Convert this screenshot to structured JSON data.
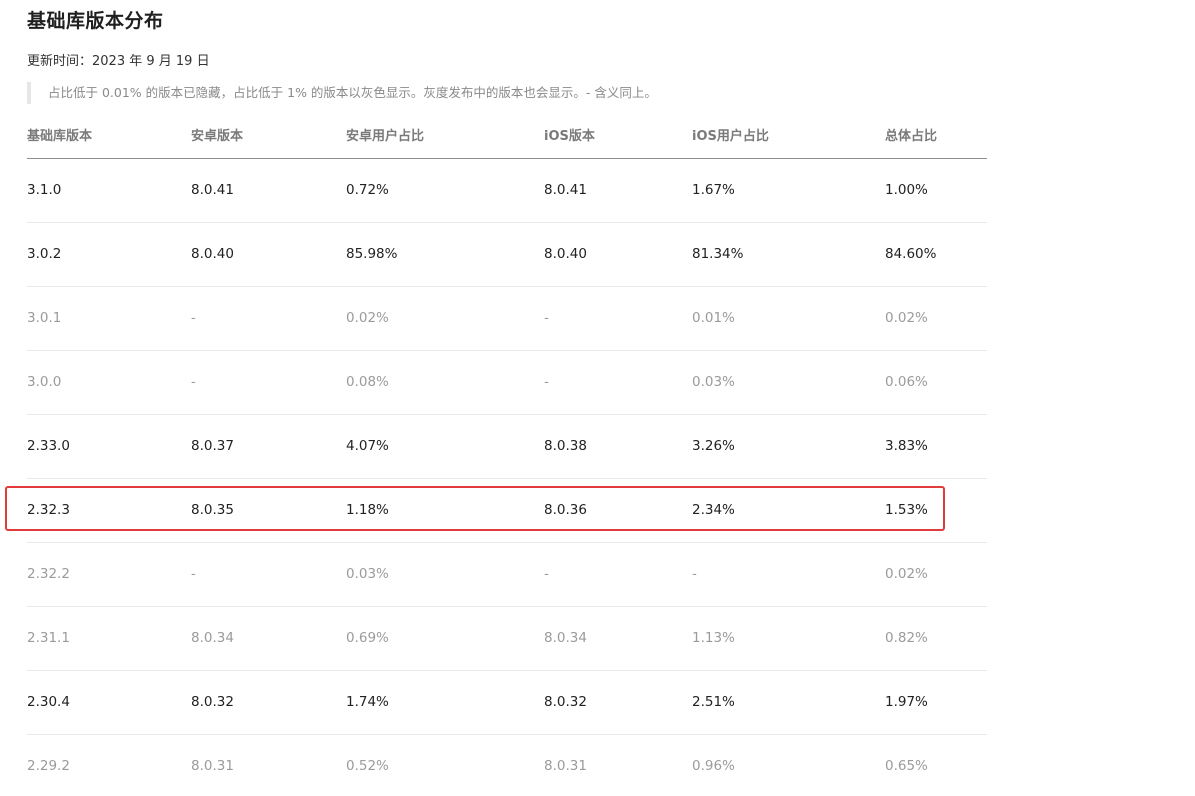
{
  "page": {
    "title": "基础库版本分布",
    "update_label": "更新时间：",
    "update_value": "2023 年 9 月 19 日",
    "note": "占比低于 0.01% 的版本已隐藏，占比低于 1% 的版本以灰色显示。灰度发布中的版本也会显示。- 含义同上。"
  },
  "table": {
    "headers": [
      "基础库版本",
      "安卓版本",
      "安卓用户占比",
      "iOS版本",
      "iOS用户占比",
      "总体占比"
    ],
    "rows": [
      {
        "lib": "3.1.0",
        "android": "8.0.41",
        "android_pct": "0.72%",
        "ios": "8.0.41",
        "ios_pct": "1.67%",
        "total": "1.00%",
        "dim": false
      },
      {
        "lib": "3.0.2",
        "android": "8.0.40",
        "android_pct": "85.98%",
        "ios": "8.0.40",
        "ios_pct": "81.34%",
        "total": "84.60%",
        "dim": false
      },
      {
        "lib": "3.0.1",
        "android": "-",
        "android_pct": "0.02%",
        "ios": "-",
        "ios_pct": "0.01%",
        "total": "0.02%",
        "dim": true
      },
      {
        "lib": "3.0.0",
        "android": "-",
        "android_pct": "0.08%",
        "ios": "-",
        "ios_pct": "0.03%",
        "total": "0.06%",
        "dim": true
      },
      {
        "lib": "2.33.0",
        "android": "8.0.37",
        "android_pct": "4.07%",
        "ios": "8.0.38",
        "ios_pct": "3.26%",
        "total": "3.83%",
        "dim": false
      },
      {
        "lib": "2.32.3",
        "android": "8.0.35",
        "android_pct": "1.18%",
        "ios": "8.0.36",
        "ios_pct": "2.34%",
        "total": "1.53%",
        "dim": false,
        "highlighted": true
      },
      {
        "lib": "2.32.2",
        "android": "-",
        "android_pct": "0.03%",
        "ios": "-",
        "ios_pct": "-",
        "total": "0.02%",
        "dim": true
      },
      {
        "lib": "2.31.1",
        "android": "8.0.34",
        "android_pct": "0.69%",
        "ios": "8.0.34",
        "ios_pct": "1.13%",
        "total": "0.82%",
        "dim": true
      },
      {
        "lib": "2.30.4",
        "android": "8.0.32",
        "android_pct": "1.74%",
        "ios": "8.0.32",
        "ios_pct": "2.51%",
        "total": "1.97%",
        "dim": false
      },
      {
        "lib": "2.29.2",
        "android": "8.0.31",
        "android_pct": "0.52%",
        "ios": "8.0.31",
        "ios_pct": "0.96%",
        "total": "0.65%",
        "dim": true
      }
    ]
  },
  "colors": {
    "highlight_border": "#e23b3b",
    "dim_text": "#9b9b9b",
    "normal_text": "#222222"
  }
}
